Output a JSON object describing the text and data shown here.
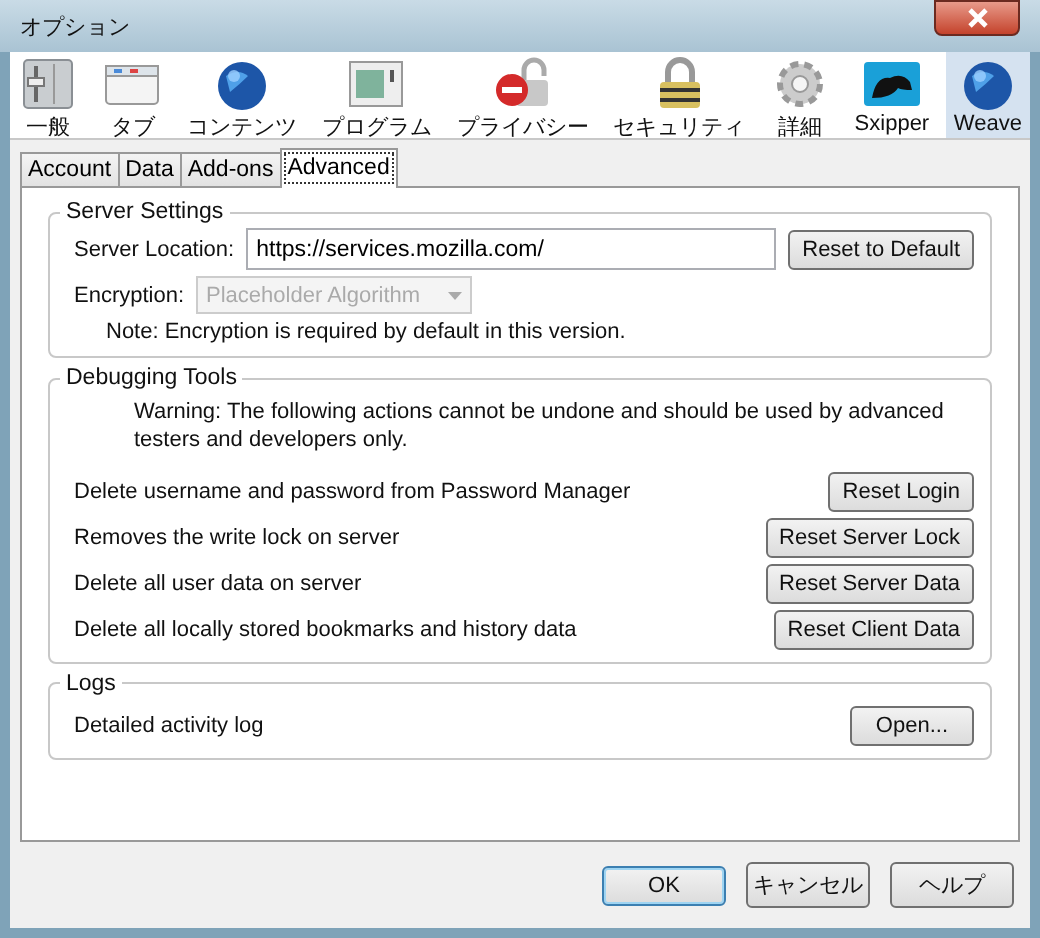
{
  "window": {
    "title": "オプション"
  },
  "toolbar": [
    {
      "label": "一般",
      "selected": false
    },
    {
      "label": "タブ",
      "selected": false
    },
    {
      "label": "コンテンツ",
      "selected": false
    },
    {
      "label": "プログラム",
      "selected": false
    },
    {
      "label": "プライバシー",
      "selected": false
    },
    {
      "label": "セキュリティ",
      "selected": false
    },
    {
      "label": "詳細",
      "selected": false
    },
    {
      "label": "Sxipper",
      "selected": false
    },
    {
      "label": "Weave",
      "selected": true
    }
  ],
  "tabs": [
    {
      "label": "Account",
      "selected": false
    },
    {
      "label": "Data",
      "selected": false
    },
    {
      "label": "Add-ons",
      "selected": false
    },
    {
      "label": "Advanced",
      "selected": true
    }
  ],
  "server_settings": {
    "title": "Server Settings",
    "location_label": "Server Location:",
    "location_value": "https://services.mozilla.com/",
    "reset_button": "Reset to Default",
    "encryption_label": "Encryption:",
    "encryption_value": "Placeholder Algorithm",
    "encryption_disabled": true,
    "note": "Note: Encryption is required by default in this version."
  },
  "debugging_tools": {
    "title": "Debugging Tools",
    "warning": "Warning: The following actions cannot be undone and should be used by advanced testers and developers only.",
    "actions": [
      {
        "description": "Delete username and password from Password Manager",
        "button": "Reset Login"
      },
      {
        "description": "Removes the write lock on server",
        "button": "Reset Server Lock"
      },
      {
        "description": "Delete all user data on server",
        "button": "Reset Server Data"
      },
      {
        "description": "Delete all locally stored bookmarks and history data",
        "button": "Reset Client Data"
      }
    ]
  },
  "logs": {
    "title": "Logs",
    "description": "Detailed activity log",
    "button": "Open..."
  },
  "buttons": [
    {
      "label": "OK",
      "default": true
    },
    {
      "label": "キャンセル",
      "default": false
    },
    {
      "label": "ヘルプ",
      "default": false
    }
  ]
}
